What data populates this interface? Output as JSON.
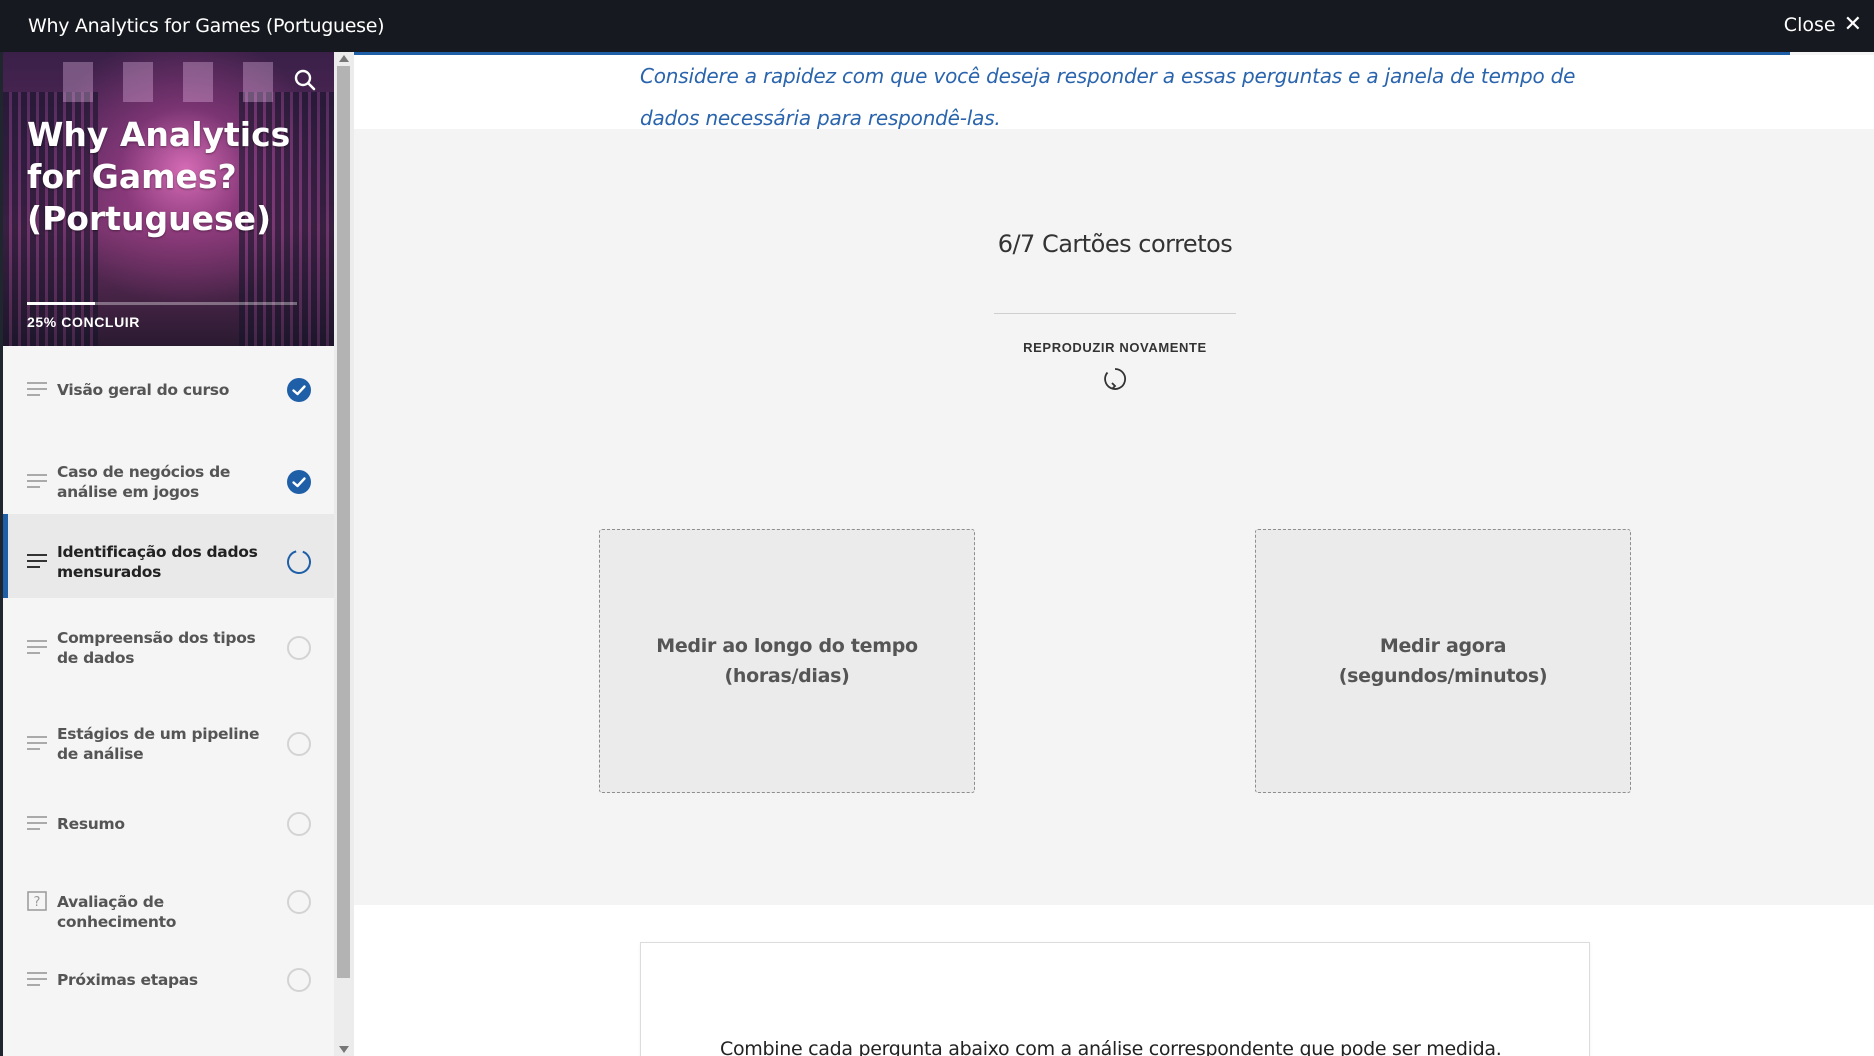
{
  "window": {
    "title": "Why Analytics for Games (Portuguese)",
    "close_label": "Close"
  },
  "sidebar": {
    "course_title": "Why Analytics for Games? (Portuguese)",
    "progress_percent": 25,
    "progress_label": "25% CONCLUIR",
    "items": [
      {
        "label": "Visão geral do curso",
        "status": "complete",
        "icon": "lines-icon"
      },
      {
        "label": "Caso de negócios de análise em jogos",
        "status": "complete",
        "icon": "lines-icon"
      },
      {
        "label": "Identificação dos dados mensurados",
        "status": "in-progress",
        "icon": "lines-icon",
        "active": true
      },
      {
        "label": "Compreensão dos tipos de dados",
        "status": "not-started",
        "icon": "lines-icon"
      },
      {
        "label": "Estágios de um pipeline de análise",
        "status": "not-started",
        "icon": "lines-icon"
      },
      {
        "label": "Resumo",
        "status": "not-started",
        "icon": "lines-icon"
      },
      {
        "label": "Avaliação de conhecimento",
        "status": "not-started",
        "icon": "quiz-icon"
      },
      {
        "label": "Próximas etapas",
        "status": "not-started",
        "icon": "lines-icon"
      }
    ]
  },
  "main": {
    "quote": "Considere a rapidez com que você deseja responder a essas perguntas e a janela de tempo de dados necessária para respondê-las.",
    "result_title": "6/7 Cartões corretos",
    "replay_label": "REPRODUZIR NOVAMENTE",
    "cards": [
      {
        "label": "Medir ao longo do tempo (horas/dias)"
      },
      {
        "label": "Medir agora (segundos/minutos)"
      }
    ],
    "instruction": "Combine cada pergunta abaixo com a análise correspondente que pode ser medida."
  },
  "colors": {
    "accent": "#1f5fa8",
    "topbar": "#161a20",
    "quote_text": "#2a64ad"
  }
}
